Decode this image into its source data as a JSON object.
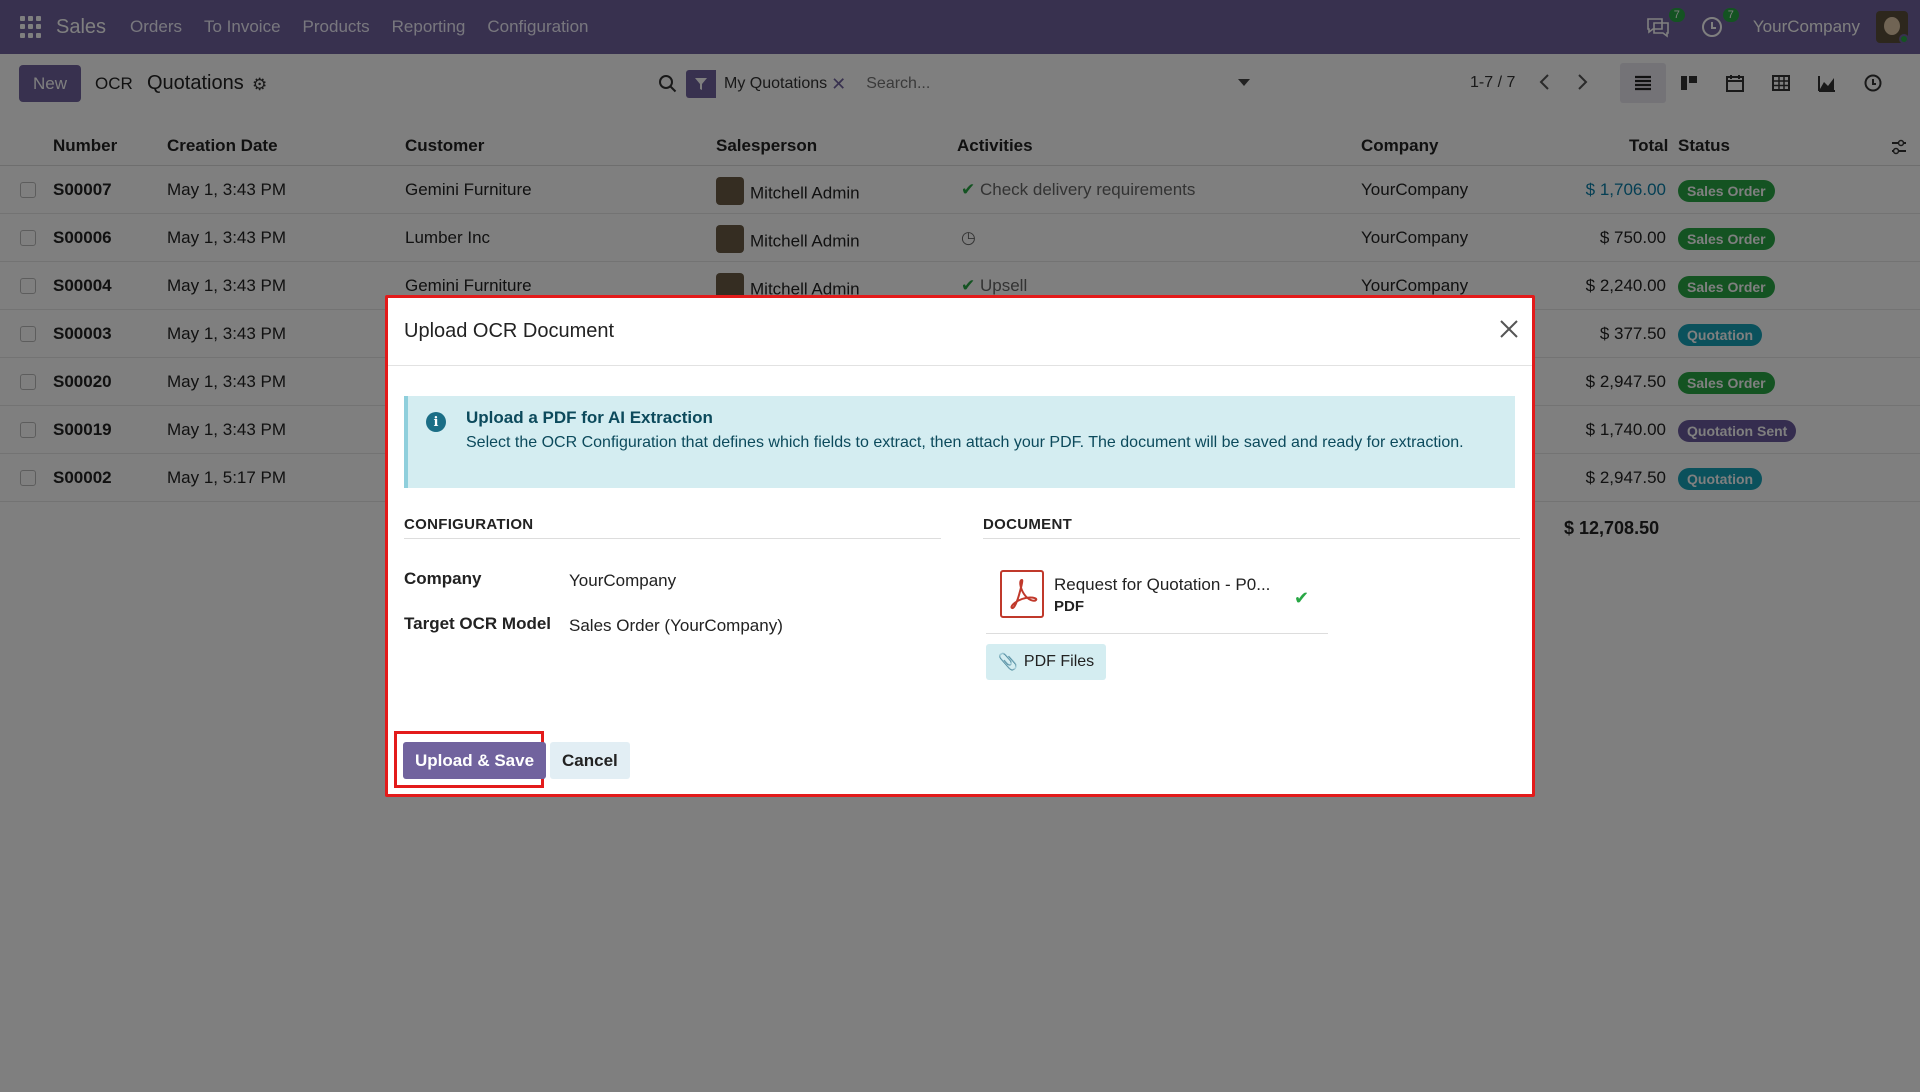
{
  "navbar": {
    "app_name": "Sales",
    "menu": [
      "Orders",
      "To Invoice",
      "Products",
      "Reporting",
      "Configuration"
    ],
    "messages_count": "7",
    "activities_count": "7",
    "company": "YourCompany"
  },
  "control": {
    "new_label": "New",
    "ocr_label": "OCR",
    "title": "Quotations",
    "facet_label": "My Quotations",
    "search_placeholder": "Search...",
    "pager": "1-7 / 7"
  },
  "list": {
    "columns": [
      "Number",
      "Creation Date",
      "Customer",
      "Salesperson",
      "Activities",
      "Company",
      "Total",
      "Status"
    ],
    "rows": [
      {
        "number": "S00007",
        "date": "May 1, 3:43 PM",
        "customer": "Gemini Furniture",
        "salesperson": "Mitchell Admin",
        "activity": "Check delivery requirements",
        "company": "YourCompany",
        "total": "$ 1,706.00",
        "status": "Sales Order"
      },
      {
        "number": "S00006",
        "date": "May 1, 3:43 PM",
        "customer": "Lumber Inc",
        "salesperson": "Mitchell Admin",
        "activity": "",
        "company": "YourCompany",
        "total": "$ 750.00",
        "status": "Sales Order"
      },
      {
        "number": "S00004",
        "date": "May 1, 3:43 PM",
        "customer": "Gemini Furniture",
        "salesperson": "Mitchell Admin",
        "activity": "Upsell",
        "company": "YourCompany",
        "total": "$ 2,240.00",
        "status": "Sales Order"
      },
      {
        "number": "S00003",
        "date": "May 1, 3:43 PM",
        "customer": "",
        "salesperson": "",
        "activity": "",
        "company": "",
        "total": "$ 377.50",
        "status": "Quotation"
      },
      {
        "number": "S00020",
        "date": "May 1, 3:43 PM",
        "customer": "",
        "salesperson": "",
        "activity": "",
        "company": "",
        "total": "$ 2,947.50",
        "status": "Sales Order"
      },
      {
        "number": "S00019",
        "date": "May 1, 3:43 PM",
        "customer": "",
        "salesperson": "",
        "activity": "",
        "company": "",
        "total": "$ 1,740.00",
        "status": "Quotation Sent"
      },
      {
        "number": "S00002",
        "date": "May 1, 5:17 PM",
        "customer": "",
        "salesperson": "",
        "activity": "",
        "company": "",
        "total": "$ 2,947.50",
        "status": "Quotation"
      }
    ],
    "grand_total": "$ 12,708.50"
  },
  "modal": {
    "title": "Upload OCR Document",
    "alert_title": "Upload a PDF for AI Extraction",
    "alert_body": "Select the OCR Configuration that defines which fields to extract, then attach your PDF. The document will be saved and ready for extraction.",
    "config_section": "CONFIGURATION",
    "doc_section": "DOCUMENT",
    "company_label": "Company",
    "company_value": "YourCompany",
    "target_label": "Target OCR Model",
    "target_value": "Sales Order (YourCompany)",
    "attachment_name": "Request for Quotation - P0...",
    "attachment_type": "PDF",
    "pdf_files_label": "PDF Files",
    "upload_label": "Upload & Save",
    "cancel_label": "Cancel"
  },
  "colors": {
    "brand": "#71639e",
    "highlight": "#e31b1b",
    "success": "#28a745",
    "info_bg": "#d4edf1"
  }
}
